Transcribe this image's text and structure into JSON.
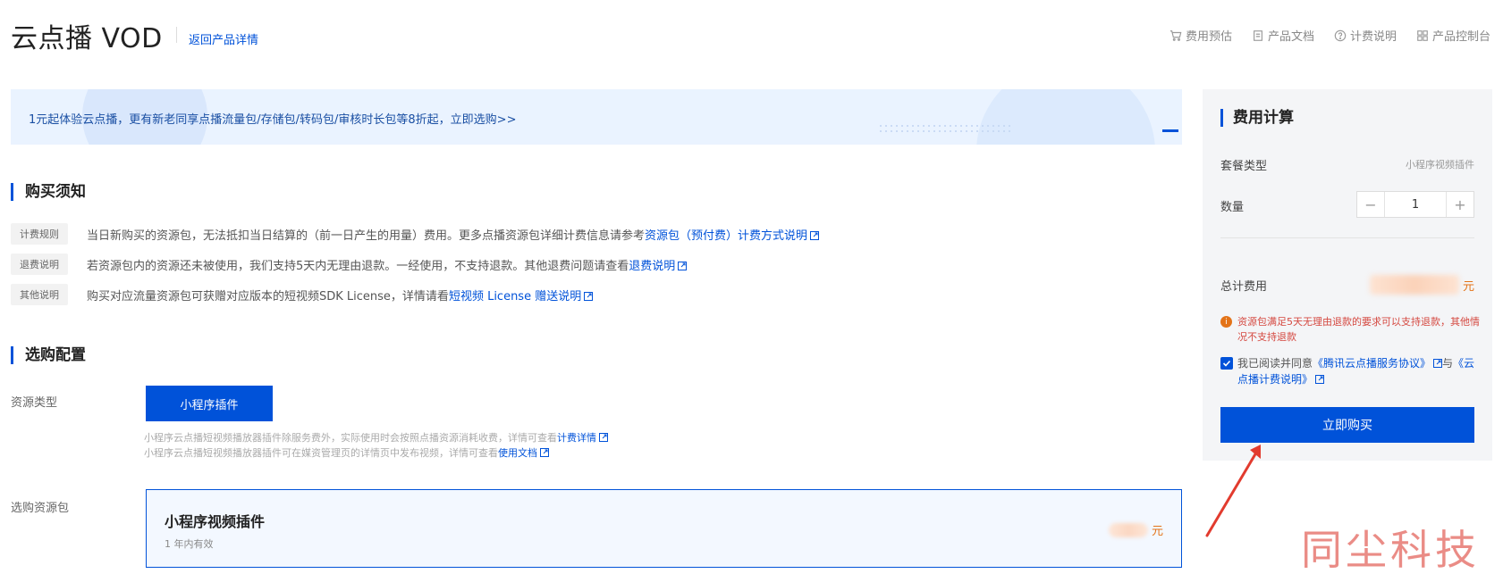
{
  "header": {
    "title": "云点播 VOD",
    "back_link": "返回产品详情",
    "links": [
      {
        "label": "费用预估",
        "icon": "cart-icon"
      },
      {
        "label": "产品文档",
        "icon": "document-icon"
      },
      {
        "label": "计费说明",
        "icon": "help-circle-icon"
      },
      {
        "label": "产品控制台",
        "icon": "grid-icon"
      }
    ]
  },
  "banner": {
    "text": "1元起体验云点播，更有新老同享点播流量包/存储包/转码包/审核时长包等8折起，立即选购>>"
  },
  "notice": {
    "title": "购买须知",
    "rows": [
      {
        "tag": "计费规则",
        "text": "当日新购买的资源包，无法抵扣当日结算的（前一日产生的用量）费用。更多点播资源包详细计费信息请参考",
        "link": "资源包（预付费）计费方式说明"
      },
      {
        "tag": "退费说明",
        "text": "若资源包内的资源还未被使用，我们支持5天内无理由退款。一经使用，不支持退款。其他退费问题请查看",
        "link": "退费说明"
      },
      {
        "tag": "其他说明",
        "text": "购买对应流量资源包可获赠对应版本的短视频SDK License，详情请看",
        "link": "短视频 License 赠送说明"
      }
    ]
  },
  "config": {
    "title": "选购配置",
    "resource_type_label": "资源类型",
    "resource_type_option": "小程序插件",
    "note1_text": "小程序云点播短视频播放器插件除服务费外，实际使用时会按照点播资源消耗收费，详情可查看",
    "note1_link": "计费详情",
    "note2_text": "小程序云点播短视频播放器插件可在媒资管理页的详情页中发布视频，详情可查看",
    "note2_link": "使用文档",
    "package_label": "选购资源包",
    "package": {
      "name": "小程序视频插件",
      "validity": "1 年内有效",
      "currency": "元"
    }
  },
  "panel": {
    "title": "费用计算",
    "package_type_label": "套餐类型",
    "package_type_value": "小程序视频插件",
    "quantity_label": "数量",
    "quantity": "1",
    "minus": "−",
    "plus": "+",
    "total_label": "总计费用",
    "currency": "元",
    "warning": "资源包满足5天无理由退款的要求可以支持退款，其他情况不支持退款",
    "agree_prefix": "我已阅读并同意",
    "agree_link1": "《腾讯云点播服务协议》",
    "agree_mid": "与",
    "agree_link2": "《云点播计费说明》",
    "buy_label": "立即购买"
  },
  "overlay": {
    "watermark": "同尘科技"
  },
  "colors": {
    "brand": "#0052d9",
    "price": "#e37318",
    "warning": "#d54941",
    "watermark": "#e8807a"
  }
}
